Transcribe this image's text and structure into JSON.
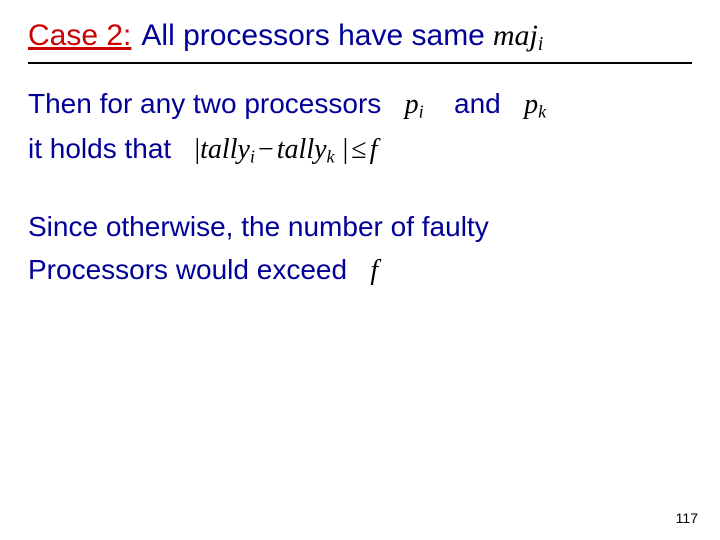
{
  "case_label": "Case 2:",
  "case_text": "All processors have same",
  "maj_base": "maj",
  "sub_i": "i",
  "line_then": "Then for any two processors",
  "p_base": "p",
  "sub_k": "k",
  "and_word": "and",
  "line_holds": "it holds that",
  "tally_base": "tally",
  "leq": "≤",
  "minus": "−",
  "f_sym": "f",
  "bar": "|",
  "since1": "Since otherwise, the number of faulty",
  "since2": "Processors would exceed",
  "page": "117"
}
